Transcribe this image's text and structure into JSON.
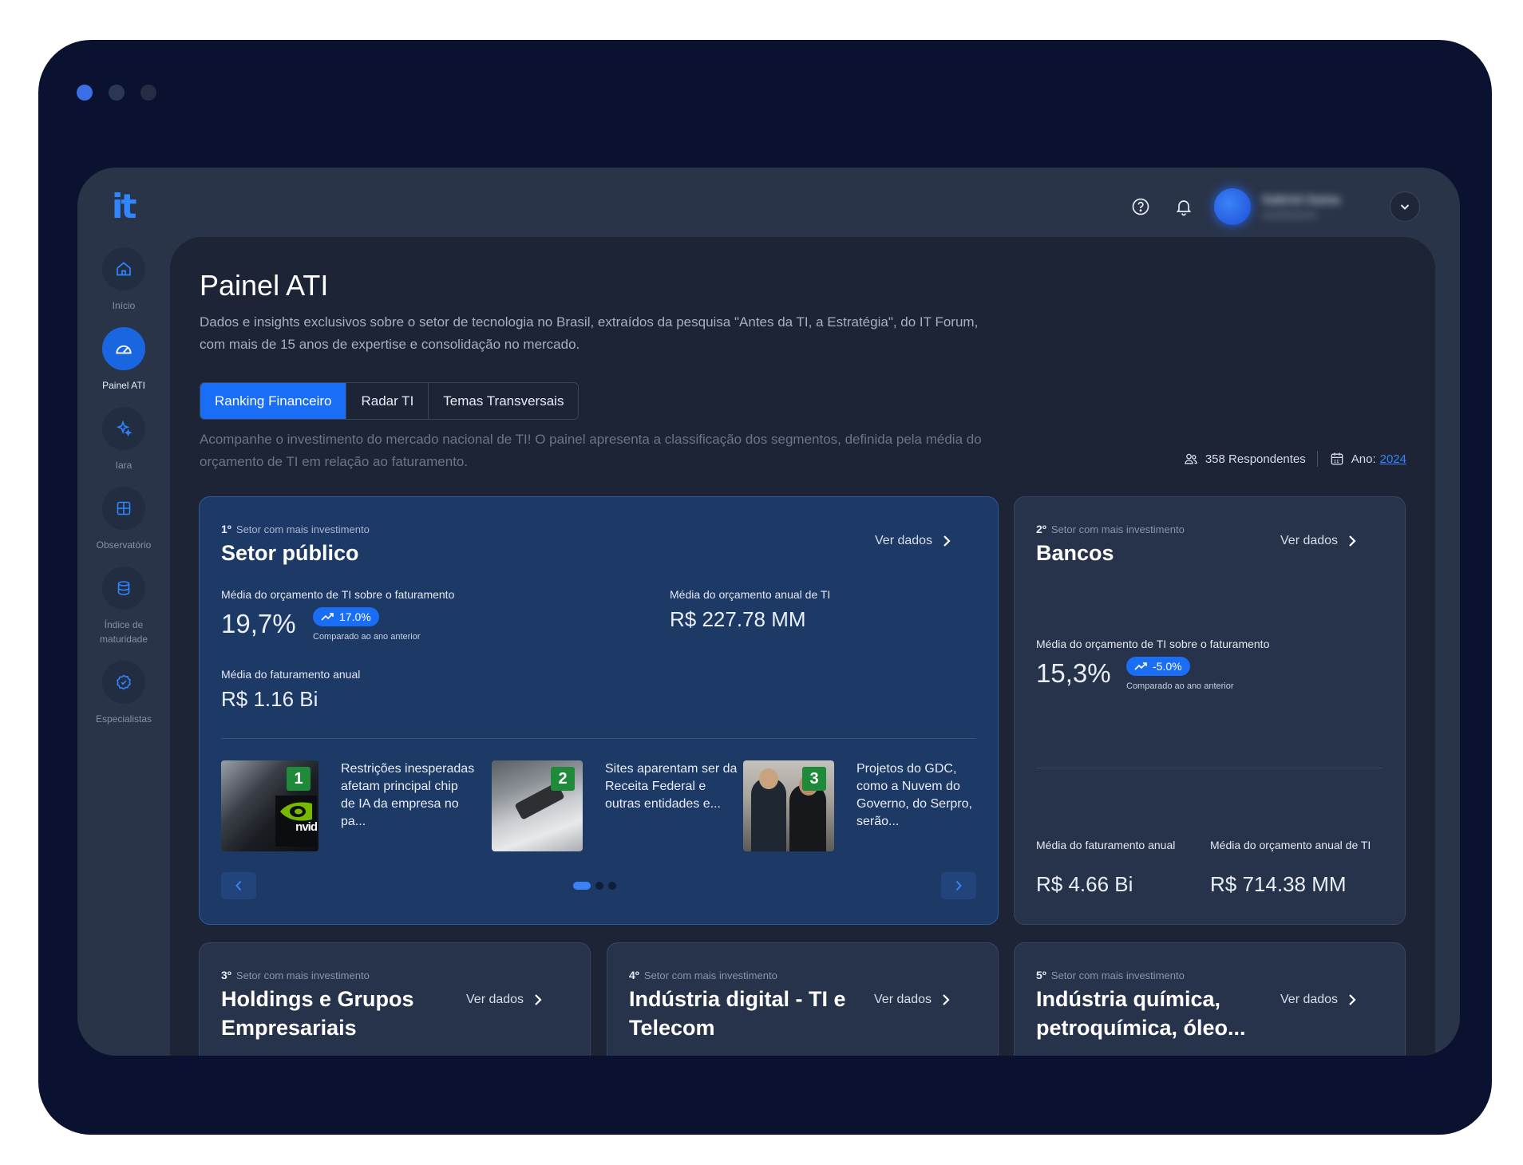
{
  "app": {
    "logo": "it"
  },
  "user": {
    "name": "Gabriel Gama",
    "role": "INGREDION"
  },
  "sidebar": {
    "items": [
      {
        "label": "Início"
      },
      {
        "label": "Painel ATI"
      },
      {
        "label": "Iara"
      },
      {
        "label": "Observatório"
      },
      {
        "label": "Índice de maturidade"
      },
      {
        "label": "Especialistas"
      }
    ]
  },
  "page": {
    "title": "Painel ATI",
    "description": "Dados e insights exclusivos sobre o setor de tecnologia no Brasil, extraídos da pesquisa \"Antes da TI, a Estratégia\", do IT Forum, com mais de 15 anos de expertise e consolidação no mercado.",
    "tabs": [
      {
        "label": "Ranking Financeiro"
      },
      {
        "label": "Radar TI"
      },
      {
        "label": "Temas Transversais"
      }
    ],
    "subtitle": "Acompanhe o investimento do mercado nacional de TI! O painel apresenta a classificação dos segmentos, definida pela média do orçamento de TI em relação ao faturamento.",
    "respondents": "358 Respondentes",
    "year_label": "Ano:",
    "year_value": "2024"
  },
  "common": {
    "rank_suffix": "Setor com mais investimento",
    "ver_dados": "Ver dados",
    "compared": "Comparado ao ano anterior",
    "label_ratio": "Média do orçamento de TI sobre o faturamento",
    "label_budget": "Média do orçamento anual de TI",
    "label_revenue": "Média do faturamento anual"
  },
  "cards": [
    {
      "rank": "1º",
      "sector": "Setor público",
      "ratio": "19,7%",
      "change": "17.0%",
      "budget": "R$ 227.78 MM",
      "revenue": "R$ 1.16 Bi"
    },
    {
      "rank": "2º",
      "sector": "Bancos",
      "ratio": "15,3%",
      "change": "-5.0%",
      "budget": "R$ 714.38 MM",
      "revenue": "R$ 4.66 Bi"
    },
    {
      "rank": "3º",
      "sector": "Holdings e Grupos Empresariais"
    },
    {
      "rank": "4º",
      "sector": "Indústria digital - TI e Telecom"
    },
    {
      "rank": "5º",
      "sector": "Indústria química, petroquímica, óleo..."
    }
  ],
  "news": [
    {
      "num": "1",
      "text": "Restrições inesperadas afetam principal chip de IA da empresa no pa..."
    },
    {
      "num": "2",
      "text": "Sites aparentam ser da Receita Federal e outras entidades e..."
    },
    {
      "num": "3",
      "text": "Projetos do GDC, como a Nuvem do Governo, do Serpro, serão..."
    }
  ],
  "colors": {
    "accent": "#1a6ef5",
    "featured_card": "#1d3966",
    "panel": "#1c2435"
  }
}
